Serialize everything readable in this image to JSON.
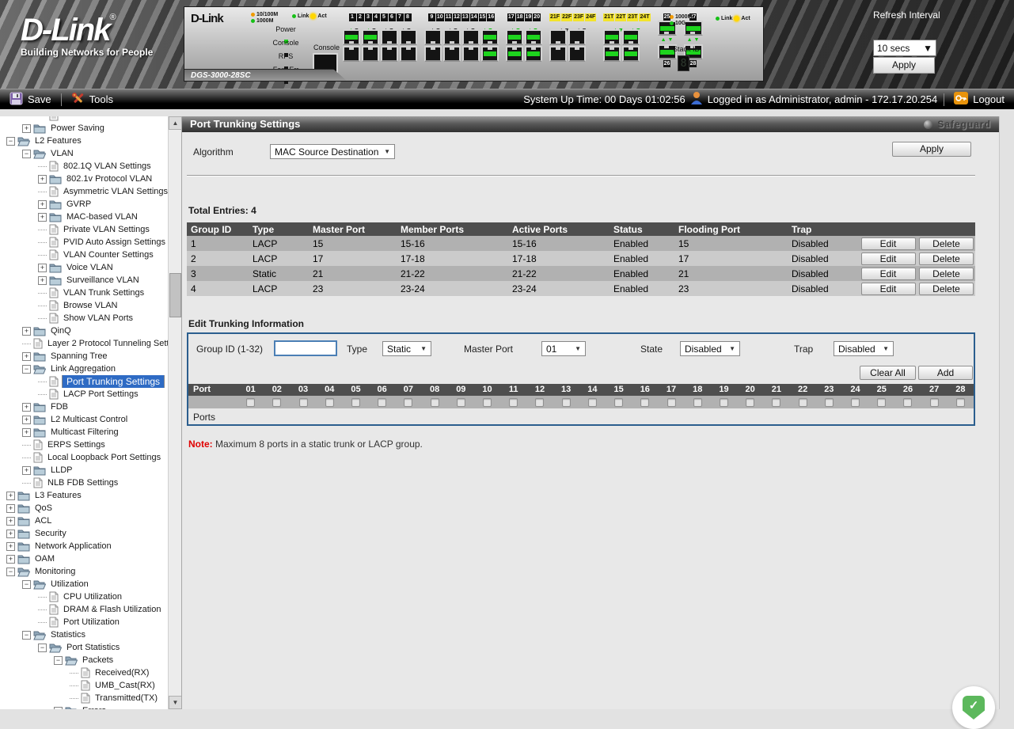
{
  "banner": {
    "logo": {
      "brand": "D-Link",
      "reg": "®",
      "tagline": "Building Networks for People"
    },
    "device": {
      "brand": "D-Link",
      "model": "DGS-3000-28SC",
      "led_labels": [
        "Power",
        "Console",
        "RPS",
        "Fan_Err"
      ],
      "led_on": [
        true,
        false,
        false,
        false
      ],
      "console_label": "Console",
      "legend_left": {
        "speed1": "10/100M",
        "speed2": "1000M",
        "link": "Link",
        "act": "Act"
      },
      "legend_right": {
        "speed1": "1000M",
        "speed2": "10G",
        "link": "Link",
        "act": "Act"
      },
      "stack_id_label": "Stack ID",
      "stack_id_value": "8",
      "port_groups": [
        {
          "label_style": "dark",
          "cols": [
            {
              "top": "1",
              "bottom": "2",
              "top_on": true,
              "bottom_on": false
            },
            {
              "top": "3",
              "bottom": "4",
              "top_on": true,
              "bottom_on": false
            },
            {
              "top": "5",
              "bottom": "6",
              "top_on": false,
              "bottom_on": false
            },
            {
              "top": "7",
              "bottom": "8",
              "top_on": false,
              "bottom_on": false
            }
          ]
        },
        {
          "label_style": "dark",
          "cols": [
            {
              "top": "9",
              "bottom": "10",
              "top_on": false,
              "bottom_on": false
            },
            {
              "top": "11",
              "bottom": "12",
              "top_on": false,
              "bottom_on": false
            },
            {
              "top": "13",
              "bottom": "14",
              "top_on": false,
              "bottom_on": false
            },
            {
              "top": "15",
              "bottom": "16",
              "top_on": true,
              "bottom_on": true
            }
          ]
        },
        {
          "label_style": "dark",
          "cols": [
            {
              "top": "17",
              "bottom": "18",
              "top_on": true,
              "bottom_on": true
            },
            {
              "top": "19",
              "bottom": "20",
              "top_on": true,
              "bottom_on": true
            }
          ]
        },
        {
          "label_style": "yellow",
          "cols": [
            {
              "top": "21F",
              "bottom": "22F",
              "top_on": false,
              "bottom_on": false
            },
            {
              "top": "23F",
              "bottom": "24F",
              "top_on": false,
              "bottom_on": false
            }
          ]
        },
        {
          "label_style": "yellow",
          "cols": [
            {
              "top": "21T",
              "bottom": "22T",
              "top_on": true,
              "bottom_on": true
            },
            {
              "top": "23T",
              "bottom": "24T",
              "top_on": true,
              "bottom_on": true
            }
          ]
        },
        {
          "label_style": "dark",
          "vertical": true,
          "cols": [
            {
              "top": "25",
              "bottom": "26",
              "top_on": true,
              "bottom_on": true
            }
          ]
        },
        {
          "label_style": "dark",
          "vertical": true,
          "cols": [
            {
              "top": "27",
              "bottom": "28",
              "top_on": true,
              "bottom_on": true
            }
          ]
        }
      ]
    },
    "refresh": {
      "label": "Refresh Interval",
      "interval_value": "10 secs",
      "apply_label": "Apply"
    }
  },
  "toolbar": {
    "save_label": "Save",
    "tools_label": "Tools",
    "uptime": "System Up Time: 00 Days 01:02:56",
    "login_info": "Logged in as Administrator, admin - 172.17.20.254",
    "logout_label": "Logout"
  },
  "sidebar": {
    "items": [
      {
        "label": "",
        "level": 2,
        "icon": "doc",
        "expand": ""
      },
      {
        "label": "Power Saving",
        "level": 1,
        "icon": "folder",
        "expand": "plus"
      },
      {
        "label": "L2 Features",
        "level": 0,
        "icon": "folder-open",
        "expand": "minus"
      },
      {
        "label": "VLAN",
        "level": 1,
        "icon": "folder-open",
        "expand": "minus"
      },
      {
        "label": "802.1Q VLAN Settings",
        "level": 2,
        "icon": "doc",
        "expand": ""
      },
      {
        "label": "802.1v Protocol VLAN",
        "level": 2,
        "icon": "folder",
        "expand": "plus"
      },
      {
        "label": "Asymmetric VLAN Settings",
        "level": 2,
        "icon": "doc",
        "expand": ""
      },
      {
        "label": "GVRP",
        "level": 2,
        "icon": "folder",
        "expand": "plus"
      },
      {
        "label": "MAC-based VLAN",
        "level": 2,
        "icon": "folder",
        "expand": "plus"
      },
      {
        "label": "Private VLAN Settings",
        "level": 2,
        "icon": "doc",
        "expand": ""
      },
      {
        "label": "PVID Auto Assign Settings",
        "level": 2,
        "icon": "doc",
        "expand": ""
      },
      {
        "label": "VLAN Counter Settings",
        "level": 2,
        "icon": "doc",
        "expand": ""
      },
      {
        "label": "Voice VLAN",
        "level": 2,
        "icon": "folder",
        "expand": "plus"
      },
      {
        "label": "Surveillance VLAN",
        "level": 2,
        "icon": "folder",
        "expand": "plus"
      },
      {
        "label": "VLAN Trunk Settings",
        "level": 2,
        "icon": "doc",
        "expand": ""
      },
      {
        "label": "Browse VLAN",
        "level": 2,
        "icon": "doc",
        "expand": ""
      },
      {
        "label": "Show VLAN Ports",
        "level": 2,
        "icon": "doc",
        "expand": ""
      },
      {
        "label": "QinQ",
        "level": 1,
        "icon": "folder",
        "expand": "plus"
      },
      {
        "label": "Layer 2 Protocol Tunneling Sett",
        "level": 1,
        "icon": "doc",
        "expand": ""
      },
      {
        "label": "Spanning Tree",
        "level": 1,
        "icon": "folder",
        "expand": "plus"
      },
      {
        "label": "Link Aggregation",
        "level": 1,
        "icon": "folder-open",
        "expand": "minus"
      },
      {
        "label": "Port Trunking Settings",
        "level": 2,
        "icon": "doc",
        "expand": "",
        "selected": true
      },
      {
        "label": "LACP Port Settings",
        "level": 2,
        "icon": "doc",
        "expand": ""
      },
      {
        "label": "FDB",
        "level": 1,
        "icon": "folder",
        "expand": "plus"
      },
      {
        "label": "L2 Multicast Control",
        "level": 1,
        "icon": "folder",
        "expand": "plus"
      },
      {
        "label": "Multicast Filtering",
        "level": 1,
        "icon": "folder",
        "expand": "plus"
      },
      {
        "label": "ERPS Settings",
        "level": 1,
        "icon": "doc",
        "expand": ""
      },
      {
        "label": "Local Loopback Port Settings",
        "level": 1,
        "icon": "doc",
        "expand": ""
      },
      {
        "label": "LLDP",
        "level": 1,
        "icon": "folder",
        "expand": "plus"
      },
      {
        "label": "NLB FDB Settings",
        "level": 1,
        "icon": "doc",
        "expand": ""
      },
      {
        "label": "L3 Features",
        "level": 0,
        "icon": "folder",
        "expand": "plus"
      },
      {
        "label": "QoS",
        "level": 0,
        "icon": "folder",
        "expand": "plus"
      },
      {
        "label": "ACL",
        "level": 0,
        "icon": "folder",
        "expand": "plus"
      },
      {
        "label": "Security",
        "level": 0,
        "icon": "folder",
        "expand": "plus"
      },
      {
        "label": "Network Application",
        "level": 0,
        "icon": "folder",
        "expand": "plus"
      },
      {
        "label": "OAM",
        "level": 0,
        "icon": "folder",
        "expand": "plus"
      },
      {
        "label": "Monitoring",
        "level": 0,
        "icon": "folder-open",
        "expand": "minus"
      },
      {
        "label": "Utilization",
        "level": 1,
        "icon": "folder-open",
        "expand": "minus"
      },
      {
        "label": "CPU Utilization",
        "level": 2,
        "icon": "doc",
        "expand": ""
      },
      {
        "label": "DRAM & Flash Utilization",
        "level": 2,
        "icon": "doc",
        "expand": ""
      },
      {
        "label": "Port Utilization",
        "level": 2,
        "icon": "doc",
        "expand": ""
      },
      {
        "label": "Statistics",
        "level": 1,
        "icon": "folder-open",
        "expand": "minus"
      },
      {
        "label": "Port Statistics",
        "level": 2,
        "icon": "folder-open",
        "expand": "minus"
      },
      {
        "label": "Packets",
        "level": 3,
        "icon": "folder-open",
        "expand": "minus"
      },
      {
        "label": "Received(RX)",
        "level": 4,
        "icon": "doc",
        "expand": ""
      },
      {
        "label": "UMB_Cast(RX)",
        "level": 4,
        "icon": "doc",
        "expand": ""
      },
      {
        "label": "Transmitted(TX)",
        "level": 4,
        "icon": "doc",
        "expand": ""
      },
      {
        "label": "Errors",
        "level": 3,
        "icon": "folder-open",
        "expand": "minus"
      }
    ]
  },
  "main": {
    "title": "Port Trunking Settings",
    "safeguard_label": "Safeguard",
    "algorithm_label": "Algorithm",
    "algorithm_value": "MAC Source Destination",
    "apply_label": "Apply",
    "total_entries": "Total Entries: 4",
    "table": {
      "headers": [
        "Group ID",
        "Type",
        "Master Port",
        "Member Ports",
        "Active Ports",
        "Status",
        "Flooding Port",
        "Trap"
      ],
      "rows": [
        [
          "1",
          "LACP",
          "15",
          "15-16",
          "15-16",
          "Enabled",
          "15",
          "Disabled"
        ],
        [
          "2",
          "LACP",
          "17",
          "17-18",
          "17-18",
          "Enabled",
          "17",
          "Disabled"
        ],
        [
          "3",
          "Static",
          "21",
          "21-22",
          "21-22",
          "Enabled",
          "21",
          "Disabled"
        ],
        [
          "4",
          "LACP",
          "23",
          "23-24",
          "23-24",
          "Enabled",
          "23",
          "Disabled"
        ]
      ],
      "edit_label": "Edit",
      "delete_label": "Delete"
    },
    "edit_section": {
      "heading": "Edit Trunking Information",
      "group_id_label": "Group ID (1-32)",
      "group_id_value": "",
      "type_label": "Type",
      "type_value": "Static",
      "master_label": "Master Port",
      "master_value": "01",
      "state_label": "State",
      "state_value": "Disabled",
      "trap_label": "Trap",
      "trap_value": "Disabled",
      "clear_all_label": "Clear All",
      "add_label": "Add",
      "port_col_label": "Port",
      "ports": [
        "01",
        "02",
        "03",
        "04",
        "05",
        "06",
        "07",
        "08",
        "09",
        "10",
        "11",
        "12",
        "13",
        "14",
        "15",
        "16",
        "17",
        "18",
        "19",
        "20",
        "21",
        "22",
        "23",
        "24",
        "25",
        "26",
        "27",
        "28"
      ],
      "ports_row_label": "Ports"
    },
    "note_label": "Note:",
    "note_text": " Maximum 8 ports in a static trunk or LACP group."
  }
}
